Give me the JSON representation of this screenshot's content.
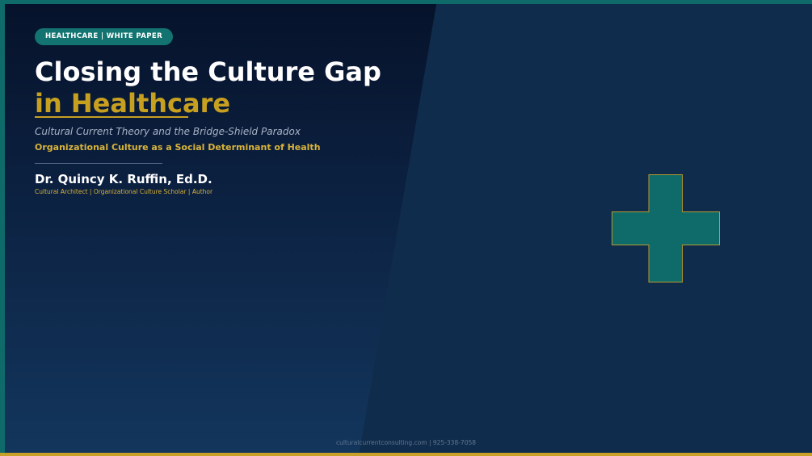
{
  "slide": {
    "badge": "HEALTHCARE  |  WHITE PAPER",
    "title_line1": "Closing the Culture Gap",
    "title_line2": "in Healthcare",
    "subtitle": "Cultural Current Theory and the Bridge-Shield Paradox",
    "tagline": "Organizational Culture as a Social Determinant of Health",
    "author": "Dr. Quincy K. Ruffin, Ed.D.",
    "roles": "Cultural Architect  |  Organizational Culture Scholar  |  Author",
    "footer": "culturalcurrentconsulting.com  |  925-338-7058",
    "icon": "medical-cross-icon"
  },
  "colors": {
    "navy_dark": "#06122a",
    "navy": "#102c4c",
    "teal": "#0e6b69",
    "gold": "#c8a020",
    "white": "#ffffff"
  }
}
